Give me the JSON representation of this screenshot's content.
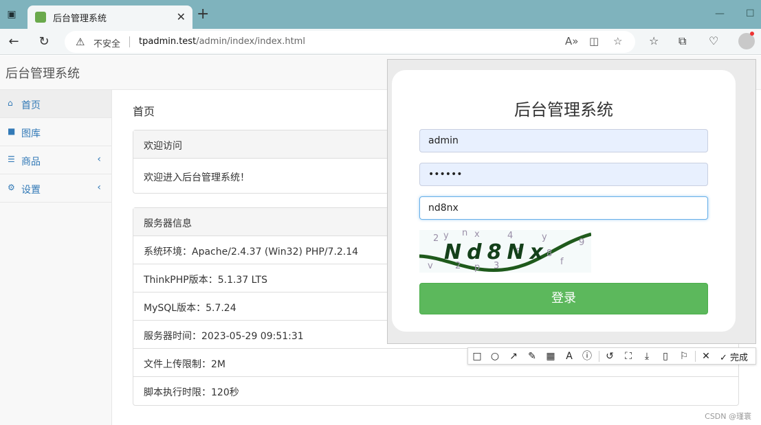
{
  "browser": {
    "tab_title": "后台管理系统",
    "security_label": "不安全",
    "url_host": "tpadmin.test",
    "url_path": "/admin/index/index.html"
  },
  "brand": "后台管理系统",
  "sidebar": {
    "items": [
      {
        "label": "首页",
        "icon": "home-icon"
      },
      {
        "label": "图库",
        "icon": "book-icon"
      },
      {
        "label": "商品",
        "icon": "list-icon"
      },
      {
        "label": "设置",
        "icon": "gear-icon"
      }
    ]
  },
  "main": {
    "title": "首页",
    "welcome_panel": {
      "heading": "欢迎访问",
      "body": "欢迎进入后台管理系统！"
    },
    "server_panel": {
      "heading": "服务器信息",
      "rows": [
        "系统环境：Apache/2.4.37 (Win32) PHP/7.2.14",
        "ThinkPHP版本：5.1.37 LTS",
        "MySQL版本：5.7.24",
        "服务器时间：2023-05-29 09:51:31",
        "文件上传限制：2M",
        "脚本执行时限：120秒"
      ]
    }
  },
  "login": {
    "title": "后台管理系统",
    "username": "admin",
    "password_mask": "••••••",
    "captcha_input": "nd8nx",
    "captcha_text": "Nd8Nx",
    "captcha_noise": [
      "2",
      "y",
      "n",
      "x",
      "4",
      "y",
      "9",
      "c",
      "3",
      "8",
      "f",
      "v",
      "2",
      "8",
      "p"
    ],
    "submit_label": "登录"
  },
  "snap_toolbar": {
    "done_label": "完成"
  },
  "watermark": "CSDN @瑾寰",
  "colors": {
    "tab_bar": "#7fb3bd",
    "primary_link": "#337ab7",
    "success": "#5cb85c"
  }
}
